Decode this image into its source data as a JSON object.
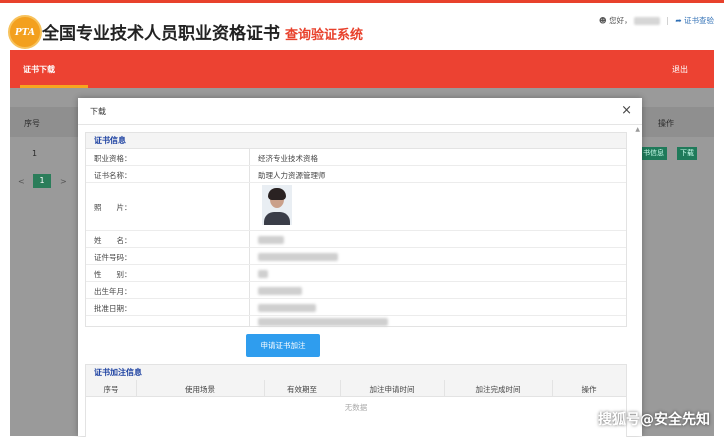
{
  "header": {
    "logo_text": "PTA",
    "title_main": "全国专业技术人员职业资格证书",
    "title_sub": "查询验证系统",
    "greeting": "您好，",
    "cert_query_link": "证书查验"
  },
  "nav": {
    "active_tab": "证书下载",
    "exit": "退出"
  },
  "background_table": {
    "headers": [
      "序号",
      "操作"
    ],
    "row_index": "1",
    "view_button": "书信息",
    "download_button": "下载",
    "pagination": {
      "current_page": "1",
      "prev": "<",
      "next": ">"
    }
  },
  "modal": {
    "title": "下载",
    "close": "×",
    "cert_info": {
      "heading": "证书信息",
      "rows": [
        {
          "label": "职业资格：",
          "value": "经济专业技术资格"
        },
        {
          "label": "证书名称：",
          "value": "助理人力资源管理师"
        },
        {
          "label": "照　　片：",
          "value": ""
        },
        {
          "label": "姓　　名：",
          "value": ""
        },
        {
          "label": "证件号码：",
          "value": ""
        },
        {
          "label": "性　　别：",
          "value": ""
        },
        {
          "label": "出生年月：",
          "value": ""
        },
        {
          "label": "批准日期：",
          "value": ""
        },
        {
          "label": "",
          "value": ""
        }
      ]
    },
    "apply_button": "申请证书加注",
    "annotation": {
      "heading": "证书加注信息",
      "columns": [
        "序号",
        "使用场景",
        "有效期至",
        "加注申请时间",
        "加注完成时间",
        "操作"
      ],
      "empty_text": "无数据"
    }
  },
  "watermark": "搜狐号@安全先知"
}
